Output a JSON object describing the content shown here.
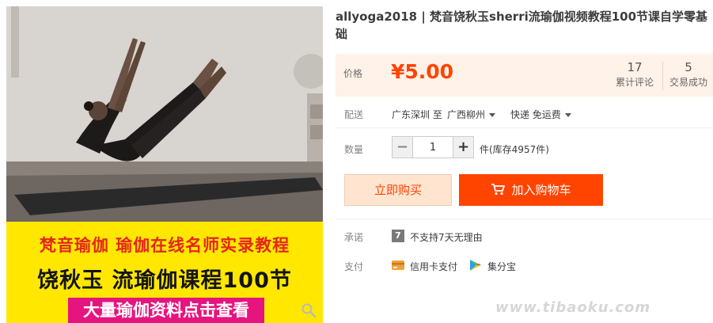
{
  "product": {
    "title": "allyoga2018 | 梵音饶秋玉sherri流瑜伽视频教程100节课自学零基础",
    "image": {
      "banner_line1": "梵音瑜伽 瑜伽在线名师实录教程",
      "banner_line2": "饶秋玉 流瑜伽课程100节",
      "banner_cta": "大量瑜伽资料点击查看",
      "zoom_icon": "magnifier-icon"
    }
  },
  "price": {
    "label": "价格",
    "value": "¥5.00",
    "reviews_count": "17",
    "reviews_label": "累计评论",
    "sales_count": "5",
    "sales_label": "交易成功"
  },
  "delivery": {
    "label": "配送",
    "from": "广东深圳 至",
    "to": "广西柳州",
    "method": "快递 免运费"
  },
  "quantity": {
    "label": "数量",
    "value": "1",
    "minus": "−",
    "plus": "+",
    "stock": "件(库存4957件)"
  },
  "actions": {
    "buy_now": "立即购买",
    "add_to_cart": "加入购物车"
  },
  "promise": {
    "label": "承诺",
    "icon_glyph": "7",
    "text": "不支持7天无理由"
  },
  "payment": {
    "label": "支付",
    "card": "信用卡支付",
    "jifen": "集分宝"
  },
  "watermark": "www.tibaoku.com",
  "colors": {
    "accent": "#ff4400",
    "price_panel_bg": "#fff2e8",
    "buy_now_bg": "#ffe4d0",
    "banner_bg": "#ffe700",
    "banner_red": "#e4261a",
    "cta_pink": "#e6147e"
  }
}
